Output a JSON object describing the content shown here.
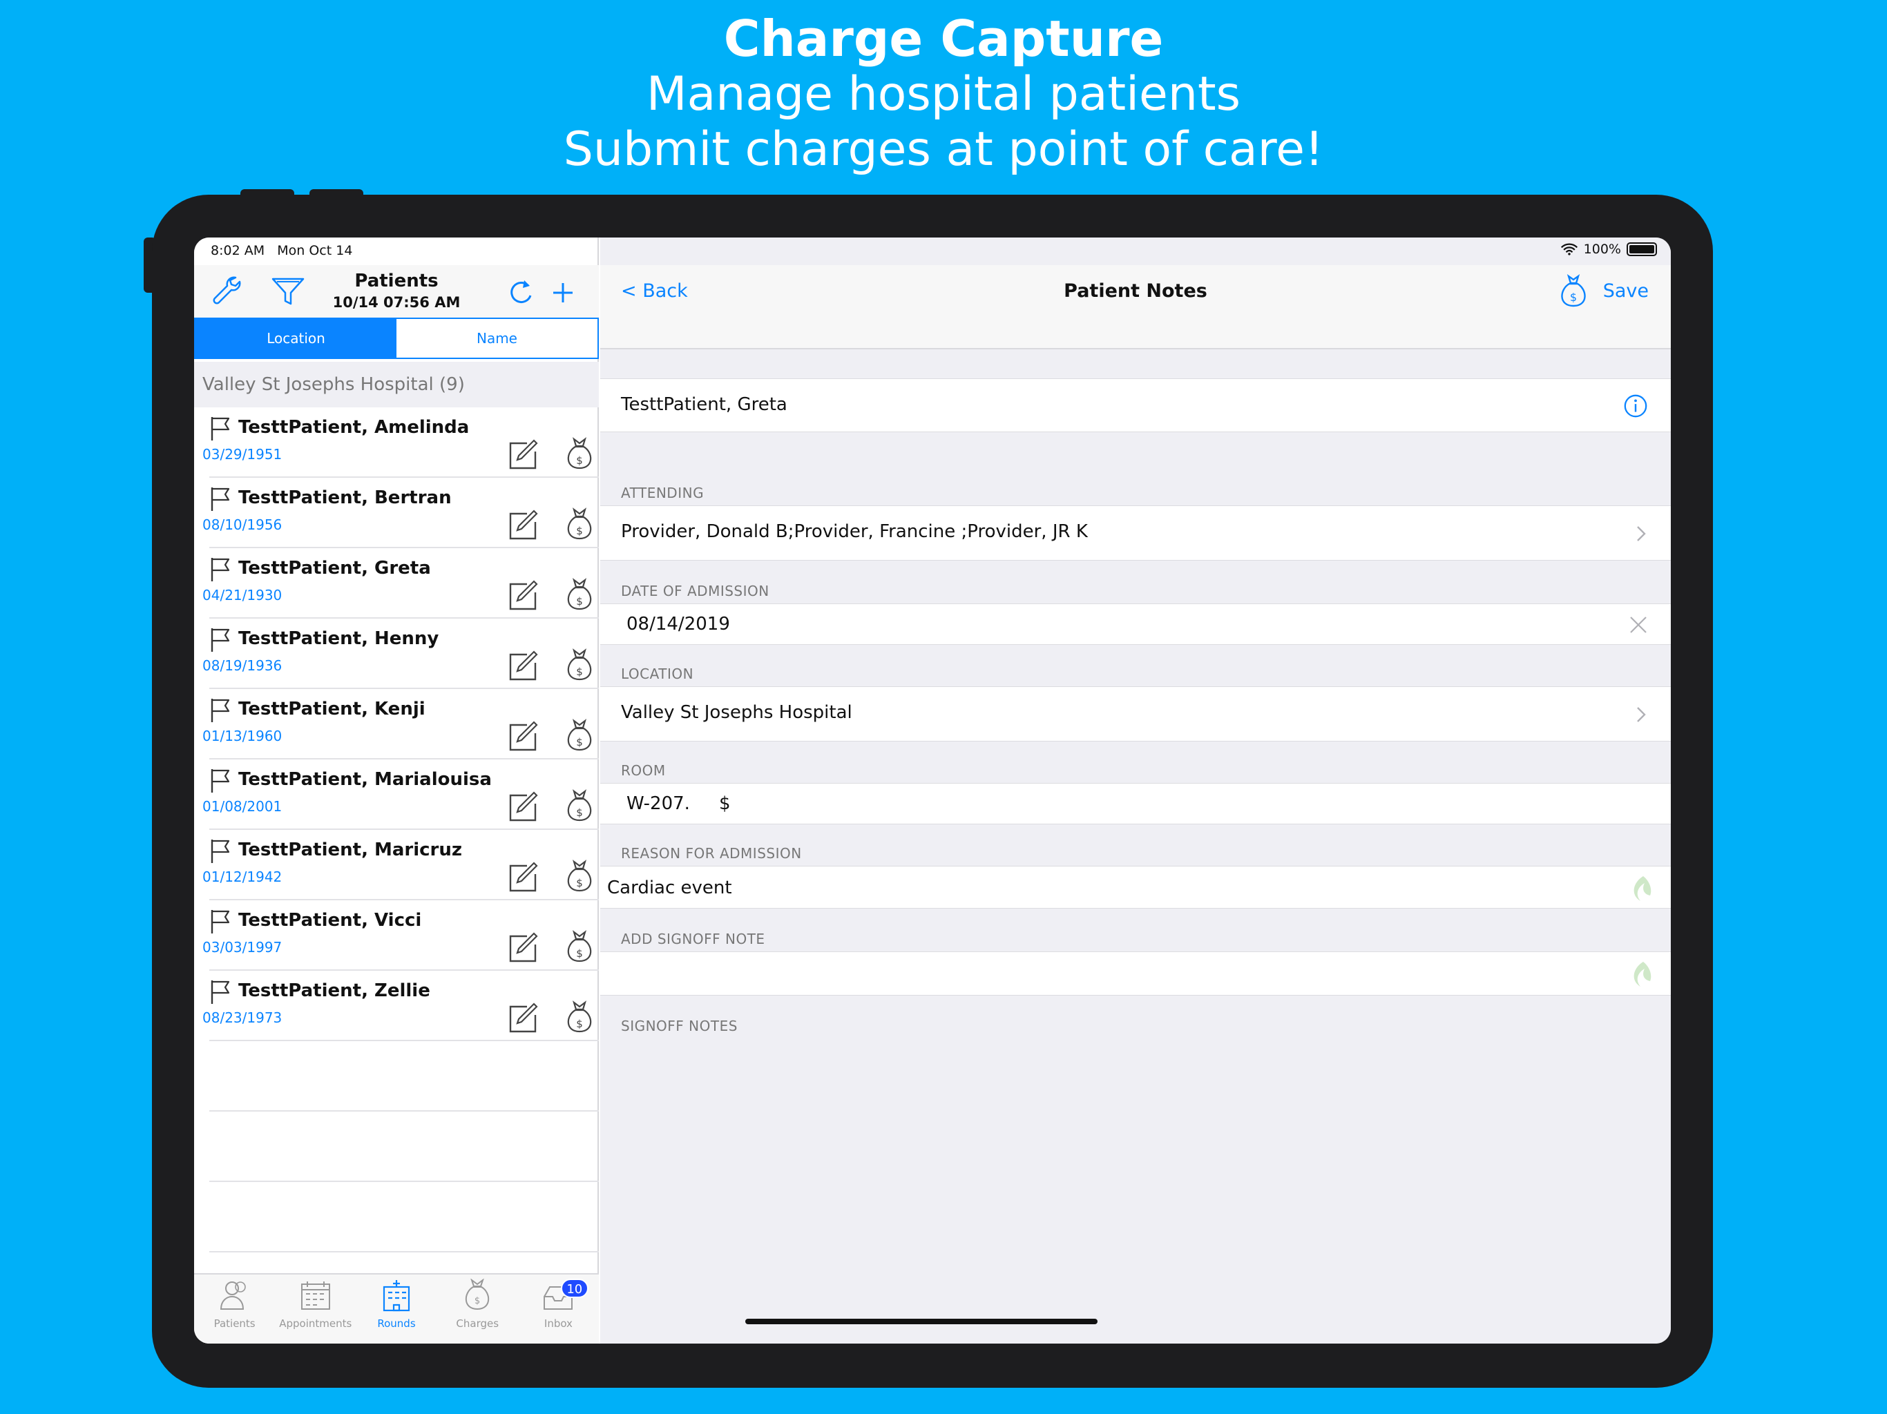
{
  "promo": {
    "title": "Charge Capture",
    "line1": "Manage hospital patients",
    "line2": "Submit charges at point of care!"
  },
  "status": {
    "time": "8:02 AM",
    "date": "Mon Oct 14",
    "battery": "100%"
  },
  "left_nav": {
    "title": "Patients",
    "subtitle": "10/14 07:56 AM"
  },
  "segment": {
    "location": "Location",
    "name": "Name"
  },
  "group": {
    "header": "Valley St Josephs Hospital (9)"
  },
  "patients": [
    {
      "name": "TesttPatient, Amelinda",
      "dob": "03/29/1951"
    },
    {
      "name": "TesttPatient, Bertran",
      "dob": "08/10/1956"
    },
    {
      "name": "TesttPatient, Greta",
      "dob": "04/21/1930"
    },
    {
      "name": "TesttPatient, Henny",
      "dob": "08/19/1936"
    },
    {
      "name": "TesttPatient, Kenji",
      "dob": "01/13/1960"
    },
    {
      "name": "TesttPatient, Marialouisa",
      "dob": "01/08/2001"
    },
    {
      "name": "TesttPatient, Maricruz",
      "dob": "01/12/1942"
    },
    {
      "name": "TesttPatient, Vicci",
      "dob": "03/03/1997"
    },
    {
      "name": "TesttPatient, Zellie",
      "dob": "08/23/1973"
    }
  ],
  "tabs": [
    {
      "label": "Patients",
      "icon": "people-icon"
    },
    {
      "label": "Appointments",
      "icon": "calendar-icon"
    },
    {
      "label": "Rounds",
      "icon": "hospital-icon"
    },
    {
      "label": "Charges",
      "icon": "money-bag-icon"
    },
    {
      "label": "Inbox",
      "icon": "inbox-icon",
      "badge": "10"
    }
  ],
  "active_tab": "Rounds",
  "right_nav": {
    "back": "< Back",
    "title": "Patient Notes",
    "save": "Save"
  },
  "notes": {
    "patient_name": "TesttPatient, Greta",
    "attending_label": "ATTENDING",
    "attending_value": "Provider, Donald B;Provider, Francine ;Provider, JR K",
    "admission_label": "DATE OF ADMISSION",
    "admission_value": "08/14/2019",
    "location_label": "LOCATION",
    "location_value": "Valley St Josephs Hospital",
    "room_label": "ROOM",
    "room_value": "W-207.",
    "room_suffix": "$",
    "reason_label": "REASON FOR ADMISSION",
    "reason_value": "Cardiac event",
    "signoff_add_label": "ADD SIGNOFF NOTE",
    "signoff_add_value": "",
    "signoff_notes_label": "SIGNOFF NOTES"
  },
  "colors": {
    "background": "#00b0f8",
    "accent": "#0a84ff",
    "badge": "#1f4bff",
    "device": "#1d1d1f"
  }
}
